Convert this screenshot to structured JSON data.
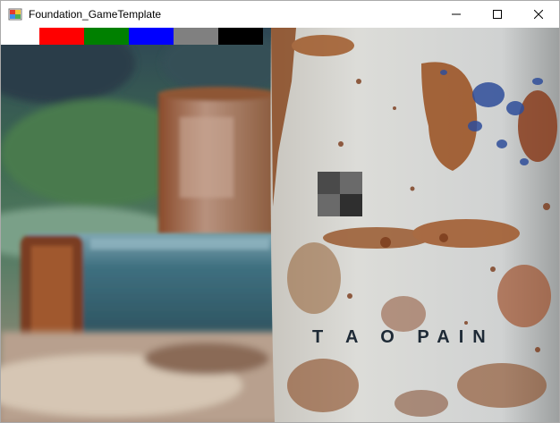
{
  "window": {
    "title": "Foundation_GameTemplate",
    "buttons": [
      "minimize",
      "maximize",
      "close"
    ]
  },
  "palette": {
    "swatches": [
      {
        "name": "white",
        "color": "#ffffff"
      },
      {
        "name": "red",
        "color": "#ff0000"
      },
      {
        "name": "green",
        "color": "#008000"
      },
      {
        "name": "blue",
        "color": "#0000ff"
      },
      {
        "name": "gray",
        "color": "#808080"
      },
      {
        "name": "black",
        "color": "#000000"
      }
    ]
  },
  "canvas": {
    "background_description_colors": {
      "rust": "#8a4a22",
      "paint_white": "#d9dde0",
      "teal_pipe": "#3f7080",
      "foliage": "#3c6a4a"
    },
    "painted_text": "T A O    PAIN",
    "checker_colors": [
      "#4a4a4a",
      "#6a6a6a",
      "#2f2f2f",
      "#5a5a5a"
    ]
  }
}
